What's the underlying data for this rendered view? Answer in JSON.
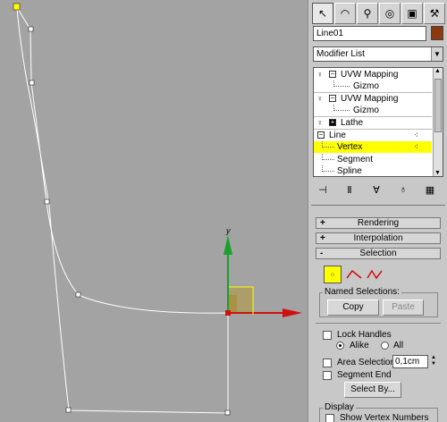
{
  "viewport": {
    "gizmo": {
      "y_label": "y"
    }
  },
  "command_panel": {
    "tabs": [
      {
        "name": "create-tab-icon",
        "glyph": "↖"
      },
      {
        "name": "modify-tab-icon",
        "glyph": "◠"
      },
      {
        "name": "hierarchy-tab-icon",
        "glyph": "⚲"
      },
      {
        "name": "motion-tab-icon",
        "glyph": "◎"
      },
      {
        "name": "display-tab-icon",
        "glyph": "▣"
      },
      {
        "name": "utilities-tab-icon",
        "glyph": "⚒"
      }
    ],
    "object_name": "Line01",
    "object_color": "#8b3a10",
    "modifier_list_label": "Modifier List",
    "stack": [
      {
        "label": "UVW Mapping",
        "type": "modifier",
        "expanded": true
      },
      {
        "label": "Gizmo",
        "type": "sub"
      },
      {
        "label": "UVW Mapping",
        "type": "modifier",
        "expanded": true
      },
      {
        "label": "Gizmo",
        "type": "sub"
      },
      {
        "label": "Lathe",
        "type": "modifier",
        "expanded": false
      },
      {
        "label": "Line",
        "type": "base",
        "expanded": true
      },
      {
        "label": "Vertex",
        "type": "sub",
        "selected": true
      },
      {
        "label": "Segment",
        "type": "sub"
      },
      {
        "label": "Spline",
        "type": "sub"
      }
    ],
    "rollouts": {
      "rendering": {
        "sign": "+",
        "label": "Rendering"
      },
      "interpolation": {
        "sign": "+",
        "label": "Interpolation"
      },
      "selection": {
        "sign": "-",
        "label": "Selection"
      }
    },
    "selection": {
      "named_selections_label": "Named Selections:",
      "copy_label": "Copy",
      "paste_label": "Paste",
      "lock_handles_label": "Lock Handles",
      "alike_label": "Alike",
      "all_label": "All",
      "area_selection_label": "Area Selection:",
      "area_selection_value": "0,1cm",
      "segment_end_label": "Segment End",
      "select_by_label": "Select By...",
      "display_label": "Display",
      "show_vertex_numbers_label": "Show Vertex Numbers"
    }
  }
}
